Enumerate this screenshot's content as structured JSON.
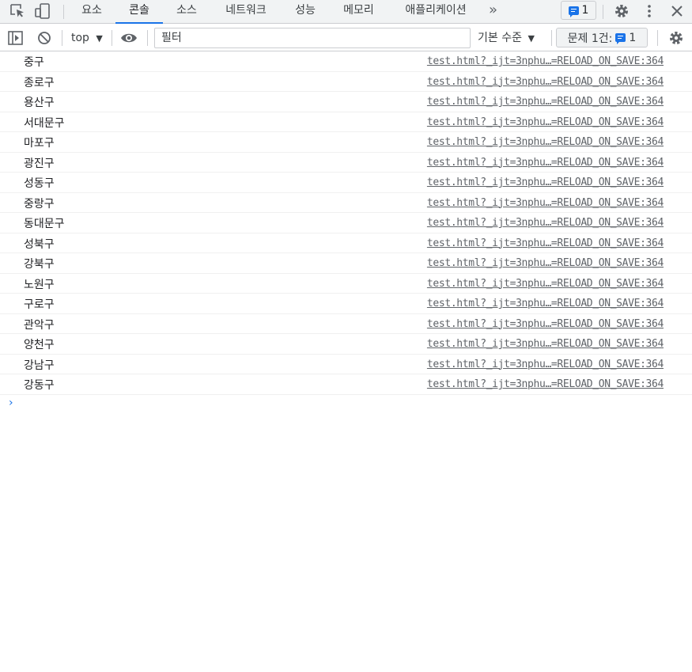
{
  "tabs": [
    "요소",
    "콘솔",
    "소스",
    "네트워크",
    "성능",
    "메모리",
    "애플리케이션"
  ],
  "active_tab": "콘솔",
  "more_tabs_icon": "»",
  "issue_badge_count": "1",
  "toolbar": {
    "context": "top",
    "filter_placeholder": "필터",
    "levels": "기본 수준",
    "issues_label": "문제 1건:",
    "issues_count": "1"
  },
  "messages": [
    {
      "text": "중구",
      "source": "test.html?_ijt=3nphu…=RELOAD_ON_SAVE:364"
    },
    {
      "text": "종로구",
      "source": "test.html?_ijt=3nphu…=RELOAD_ON_SAVE:364"
    },
    {
      "text": "용산구",
      "source": "test.html?_ijt=3nphu…=RELOAD_ON_SAVE:364"
    },
    {
      "text": "서대문구",
      "source": "test.html?_ijt=3nphu…=RELOAD_ON_SAVE:364"
    },
    {
      "text": "마포구",
      "source": "test.html?_ijt=3nphu…=RELOAD_ON_SAVE:364"
    },
    {
      "text": "광진구",
      "source": "test.html?_ijt=3nphu…=RELOAD_ON_SAVE:364"
    },
    {
      "text": "성동구",
      "source": "test.html?_ijt=3nphu…=RELOAD_ON_SAVE:364"
    },
    {
      "text": "중랑구",
      "source": "test.html?_ijt=3nphu…=RELOAD_ON_SAVE:364"
    },
    {
      "text": "동대문구",
      "source": "test.html?_ijt=3nphu…=RELOAD_ON_SAVE:364"
    },
    {
      "text": "성북구",
      "source": "test.html?_ijt=3nphu…=RELOAD_ON_SAVE:364"
    },
    {
      "text": "강북구",
      "source": "test.html?_ijt=3nphu…=RELOAD_ON_SAVE:364"
    },
    {
      "text": "노원구",
      "source": "test.html?_ijt=3nphu…=RELOAD_ON_SAVE:364"
    },
    {
      "text": "구로구",
      "source": "test.html?_ijt=3nphu…=RELOAD_ON_SAVE:364"
    },
    {
      "text": "관악구",
      "source": "test.html?_ijt=3nphu…=RELOAD_ON_SAVE:364"
    },
    {
      "text": "양천구",
      "source": "test.html?_ijt=3nphu…=RELOAD_ON_SAVE:364"
    },
    {
      "text": "강남구",
      "source": "test.html?_ijt=3nphu…=RELOAD_ON_SAVE:364"
    },
    {
      "text": "강동구",
      "source": "test.html?_ijt=3nphu…=RELOAD_ON_SAVE:364"
    }
  ],
  "prompt_symbol": "›",
  "icons": {
    "inspect": "inspect-element-icon",
    "device": "device-toolbar-icon",
    "settings": "gear-icon",
    "more": "kebab-menu-icon",
    "close": "close-icon",
    "sidebar": "sidebar-toggle-icon",
    "clear": "clear-console-icon",
    "eye": "live-expression-eye-icon"
  },
  "colors": {
    "accent": "#1a73e8",
    "toolbar_bg": "#f1f3f4"
  }
}
